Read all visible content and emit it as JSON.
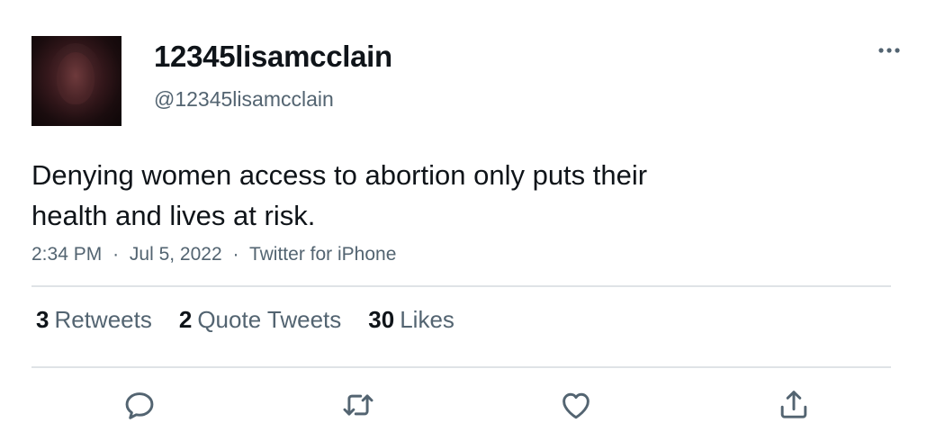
{
  "tweet": {
    "display_name": "12345lisamcclain",
    "handle": "@12345lisamcclain",
    "text_line1": "Denying women access to abortion only puts their",
    "text_line2": "health and lives at risk.",
    "time": "2:34 PM",
    "separator": "·",
    "date": "Jul 5, 2022",
    "source": "Twitter for iPhone"
  },
  "stats": {
    "retweets_count": "3",
    "retweets_label": "Retweets",
    "quotes_count": "2",
    "quotes_label": "Quote Tweets",
    "likes_count": "30",
    "likes_label": "Likes"
  },
  "icons": {
    "more": "more-horizontal-icon",
    "reply": "reply-icon",
    "retweet": "retweet-icon",
    "like": "heart-icon",
    "share": "share-icon"
  },
  "colors": {
    "text_primary": "#0f1419",
    "text_secondary": "#536471",
    "divider": "#dfe3e6",
    "icon": "#536471"
  }
}
